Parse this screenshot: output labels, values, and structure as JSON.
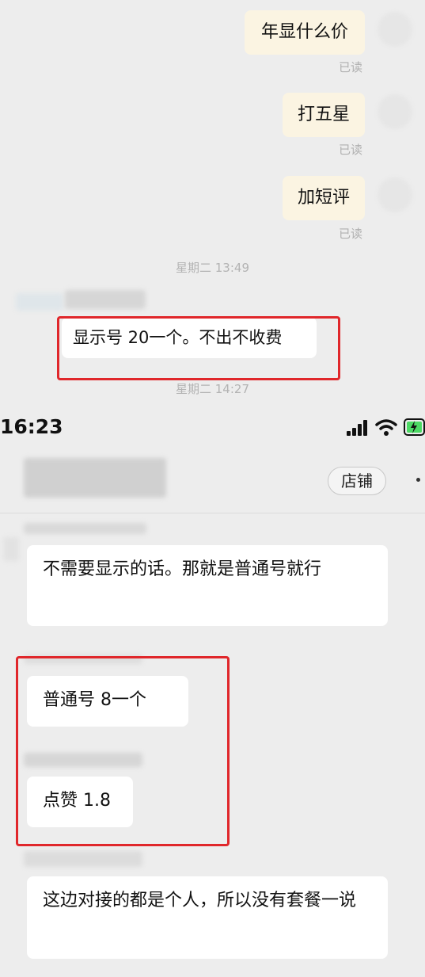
{
  "top_chat": {
    "outgoing": [
      {
        "text": "年显什么价",
        "status": "已读"
      },
      {
        "text": "打五星",
        "status": "已读"
      },
      {
        "text": "加短评",
        "status": "已读"
      }
    ],
    "timestamp_1": "星期二 13:49",
    "incoming_message": "显示号 20一个。不出不收费",
    "timestamp_2": "星期二 14:27"
  },
  "status_bar": {
    "time": "16:23"
  },
  "header": {
    "shop_button": "店铺"
  },
  "messages": [
    {
      "text": "不需要显示的话。那就是普通号就行"
    },
    {
      "text": "普通号 8一个"
    },
    {
      "text": "点赞 1.8"
    },
    {
      "text": "这边对接的都是个人，所以没有套餐一说"
    }
  ],
  "colors": {
    "highlight_box": "#e0272b",
    "outgoing_bubble": "#fbf4e2",
    "incoming_bubble": "#ffffff",
    "background": "#ededed"
  }
}
